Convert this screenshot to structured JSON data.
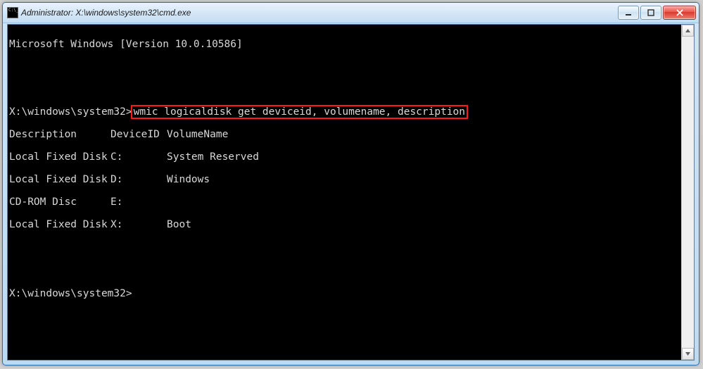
{
  "window": {
    "title": "Administrator: X:\\windows\\system32\\cmd.exe"
  },
  "terminal": {
    "version_line": "Microsoft Windows [Version 10.0.10586]",
    "prompt_path": "X:\\windows\\system32>",
    "highlighted_command": "wmic logicaldisk get deviceid, volumename, description",
    "headers": {
      "description": "Description",
      "deviceid": "DeviceID",
      "volumename": "VolumeName"
    },
    "rows": [
      {
        "description": "Local Fixed Disk",
        "deviceid": "C:",
        "volumename": "System Reserved"
      },
      {
        "description": "Local Fixed Disk",
        "deviceid": "D:",
        "volumename": "Windows"
      },
      {
        "description": "CD-ROM Disc",
        "deviceid": "E:",
        "volumename": ""
      },
      {
        "description": "Local Fixed Disk",
        "deviceid": "X:",
        "volumename": "Boot"
      }
    ],
    "second_prompt": "X:\\windows\\system32>"
  }
}
